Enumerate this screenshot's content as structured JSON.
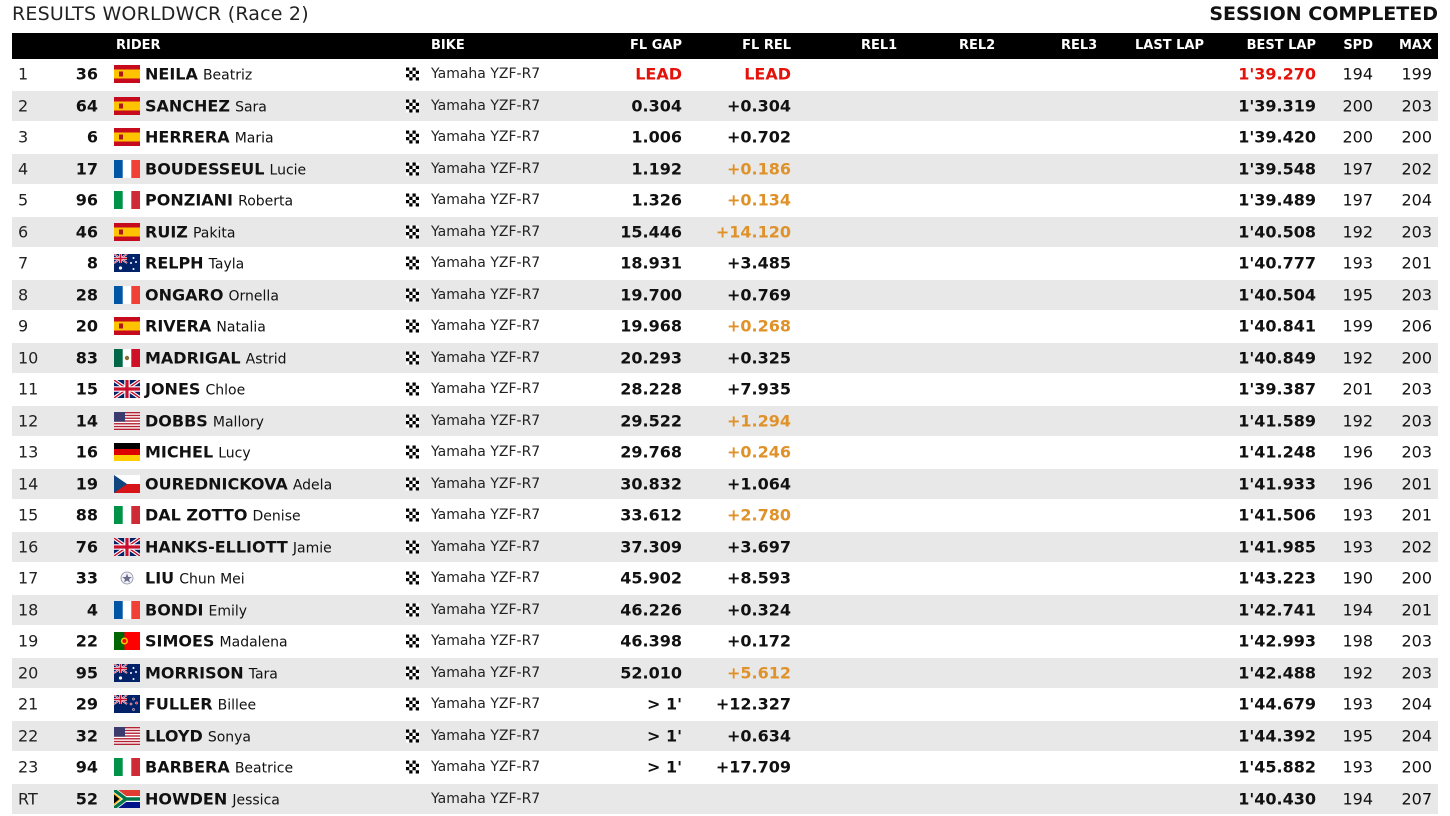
{
  "header": {
    "title": "RESULTS WORLDWCR (Race 2)",
    "status": "SESSION COMPLETED"
  },
  "columns": {
    "rider": "RIDER",
    "bike": "BIKE",
    "fl_gap": "FL GAP",
    "fl_rel": "FL REL",
    "rel1": "REL1",
    "rel2": "REL2",
    "rel3": "REL3",
    "last_lap": "LAST LAP",
    "best_lap": "BEST LAP",
    "spd": "SPD",
    "max": "MAX"
  },
  "colors": {
    "lead": "#e3120b",
    "improved": "#e0922a",
    "header_bg": "#000000",
    "row_alt": "#e8e8e8"
  },
  "rows": [
    {
      "pos": "1",
      "num": "36",
      "flag": "ESP",
      "surname": "NEILA",
      "first": "Beatriz",
      "finish": true,
      "bike": "Yamaha YZF-R7",
      "fl_gap": "LEAD",
      "fl_rel": "LEAD",
      "fl_gap_color": "red",
      "fl_rel_color": "red",
      "best": "1'39.270",
      "best_color": "red",
      "spd": "194",
      "max": "199"
    },
    {
      "pos": "2",
      "num": "64",
      "flag": "ESP",
      "surname": "SANCHEZ",
      "first": "Sara",
      "finish": true,
      "bike": "Yamaha YZF-R7",
      "fl_gap": "0.304",
      "fl_rel": "+0.304",
      "fl_rel_color": "",
      "best": "1'39.319",
      "spd": "200",
      "max": "203"
    },
    {
      "pos": "3",
      "num": "6",
      "flag": "ESP",
      "surname": "HERRERA",
      "first": "Maria",
      "finish": true,
      "bike": "Yamaha YZF-R7",
      "fl_gap": "1.006",
      "fl_rel": "+0.702",
      "fl_rel_color": "",
      "best": "1'39.420",
      "spd": "200",
      "max": "200"
    },
    {
      "pos": "4",
      "num": "17",
      "flag": "FRA",
      "surname": "BOUDESSEUL",
      "first": "Lucie",
      "finish": true,
      "bike": "Yamaha YZF-R7",
      "fl_gap": "1.192",
      "fl_rel": "+0.186",
      "fl_rel_color": "orange",
      "best": "1'39.548",
      "spd": "197",
      "max": "202"
    },
    {
      "pos": "5",
      "num": "96",
      "flag": "ITA",
      "surname": "PONZIANI",
      "first": "Roberta",
      "finish": true,
      "bike": "Yamaha YZF-R7",
      "fl_gap": "1.326",
      "fl_rel": "+0.134",
      "fl_rel_color": "orange",
      "best": "1'39.489",
      "spd": "197",
      "max": "204"
    },
    {
      "pos": "6",
      "num": "46",
      "flag": "ESP",
      "surname": "RUIZ",
      "first": "Pakita",
      "finish": true,
      "bike": "Yamaha YZF-R7",
      "fl_gap": "15.446",
      "fl_rel": "+14.120",
      "fl_rel_color": "orange",
      "best": "1'40.508",
      "spd": "192",
      "max": "203"
    },
    {
      "pos": "7",
      "num": "8",
      "flag": "AUS",
      "surname": "RELPH",
      "first": "Tayla",
      "finish": true,
      "bike": "Yamaha YZF-R7",
      "fl_gap": "18.931",
      "fl_rel": "+3.485",
      "fl_rel_color": "",
      "best": "1'40.777",
      "spd": "193",
      "max": "201"
    },
    {
      "pos": "8",
      "num": "28",
      "flag": "FRA",
      "surname": "ONGARO",
      "first": "Ornella",
      "finish": true,
      "bike": "Yamaha YZF-R7",
      "fl_gap": "19.700",
      "fl_rel": "+0.769",
      "fl_rel_color": "",
      "best": "1'40.504",
      "spd": "195",
      "max": "203"
    },
    {
      "pos": "9",
      "num": "20",
      "flag": "ESP",
      "surname": "RIVERA",
      "first": "Natalia",
      "finish": true,
      "bike": "Yamaha YZF-R7",
      "fl_gap": "19.968",
      "fl_rel": "+0.268",
      "fl_rel_color": "orange",
      "best": "1'40.841",
      "spd": "199",
      "max": "206"
    },
    {
      "pos": "10",
      "num": "83",
      "flag": "MEX",
      "surname": "MADRIGAL",
      "first": "Astrid",
      "finish": true,
      "bike": "Yamaha YZF-R7",
      "fl_gap": "20.293",
      "fl_rel": "+0.325",
      "fl_rel_color": "",
      "best": "1'40.849",
      "spd": "192",
      "max": "200"
    },
    {
      "pos": "11",
      "num": "15",
      "flag": "GBR",
      "surname": "JONES",
      "first": "Chloe",
      "finish": true,
      "bike": "Yamaha YZF-R7",
      "fl_gap": "28.228",
      "fl_rel": "+7.935",
      "fl_rel_color": "",
      "best": "1'39.387",
      "spd": "201",
      "max": "203"
    },
    {
      "pos": "12",
      "num": "14",
      "flag": "USA",
      "surname": "DOBBS",
      "first": "Mallory",
      "finish": true,
      "bike": "Yamaha YZF-R7",
      "fl_gap": "29.522",
      "fl_rel": "+1.294",
      "fl_rel_color": "orange",
      "best": "1'41.589",
      "spd": "192",
      "max": "203"
    },
    {
      "pos": "13",
      "num": "16",
      "flag": "GER",
      "surname": "MICHEL",
      "first": "Lucy",
      "finish": true,
      "bike": "Yamaha YZF-R7",
      "fl_gap": "29.768",
      "fl_rel": "+0.246",
      "fl_rel_color": "orange",
      "best": "1'41.248",
      "spd": "196",
      "max": "203"
    },
    {
      "pos": "14",
      "num": "19",
      "flag": "CZE",
      "surname": "OUREDNICKOVA",
      "first": "Adela",
      "finish": true,
      "bike": "Yamaha YZF-R7",
      "fl_gap": "30.832",
      "fl_rel": "+1.064",
      "fl_rel_color": "",
      "best": "1'41.933",
      "spd": "196",
      "max": "201"
    },
    {
      "pos": "15",
      "num": "88",
      "flag": "ITA",
      "surname": "DAL ZOTTO",
      "first": "Denise",
      "finish": true,
      "bike": "Yamaha YZF-R7",
      "fl_gap": "33.612",
      "fl_rel": "+2.780",
      "fl_rel_color": "orange",
      "best": "1'41.506",
      "spd": "193",
      "max": "201"
    },
    {
      "pos": "16",
      "num": "76",
      "flag": "GBR",
      "surname": "HANKS-ELLIOTT",
      "first": "Jamie",
      "finish": true,
      "bike": "Yamaha YZF-R7",
      "fl_gap": "37.309",
      "fl_rel": "+3.697",
      "fl_rel_color": "",
      "best": "1'41.985",
      "spd": "193",
      "max": "202"
    },
    {
      "pos": "17",
      "num": "33",
      "flag": "TPE",
      "surname": "LIU",
      "first": "Chun Mei",
      "finish": true,
      "bike": "Yamaha YZF-R7",
      "fl_gap": "45.902",
      "fl_rel": "+8.593",
      "fl_rel_color": "",
      "best": "1'43.223",
      "spd": "190",
      "max": "200"
    },
    {
      "pos": "18",
      "num": "4",
      "flag": "FRA",
      "surname": "BONDI",
      "first": "Emily",
      "finish": true,
      "bike": "Yamaha YZF-R7",
      "fl_gap": "46.226",
      "fl_rel": "+0.324",
      "fl_rel_color": "",
      "best": "1'42.741",
      "spd": "194",
      "max": "201"
    },
    {
      "pos": "19",
      "num": "22",
      "flag": "POR",
      "surname": "SIMOES",
      "first": "Madalena",
      "finish": true,
      "bike": "Yamaha YZF-R7",
      "fl_gap": "46.398",
      "fl_rel": "+0.172",
      "fl_rel_color": "",
      "best": "1'42.993",
      "spd": "198",
      "max": "203"
    },
    {
      "pos": "20",
      "num": "95",
      "flag": "AUS",
      "surname": "MORRISON",
      "first": "Tara",
      "finish": true,
      "bike": "Yamaha YZF-R7",
      "fl_gap": "52.010",
      "fl_rel": "+5.612",
      "fl_rel_color": "orange",
      "best": "1'42.488",
      "spd": "192",
      "max": "203"
    },
    {
      "pos": "21",
      "num": "29",
      "flag": "NZL",
      "surname": "FULLER",
      "first": "Billee",
      "finish": true,
      "bike": "Yamaha YZF-R7",
      "fl_gap": "> 1'",
      "fl_rel": "+12.327",
      "fl_rel_color": "",
      "best": "1'44.679",
      "spd": "193",
      "max": "204"
    },
    {
      "pos": "22",
      "num": "32",
      "flag": "USA",
      "surname": "LLOYD",
      "first": "Sonya",
      "finish": true,
      "bike": "Yamaha YZF-R7",
      "fl_gap": "> 1'",
      "fl_rel": "+0.634",
      "fl_rel_color": "",
      "best": "1'44.392",
      "spd": "195",
      "max": "204"
    },
    {
      "pos": "23",
      "num": "94",
      "flag": "ITA",
      "surname": "BARBERA",
      "first": "Beatrice",
      "finish": true,
      "bike": "Yamaha YZF-R7",
      "fl_gap": "> 1'",
      "fl_rel": "+17.709",
      "fl_rel_color": "",
      "best": "1'45.882",
      "spd": "193",
      "max": "200"
    },
    {
      "pos": "RT",
      "num": "52",
      "flag": "RSA",
      "surname": "HOWDEN",
      "first": "Jessica",
      "finish": false,
      "bike": "Yamaha YZF-R7",
      "fl_gap": "",
      "fl_rel": "",
      "fl_rel_color": "",
      "best": "1'40.430",
      "spd": "194",
      "max": "207"
    }
  ]
}
